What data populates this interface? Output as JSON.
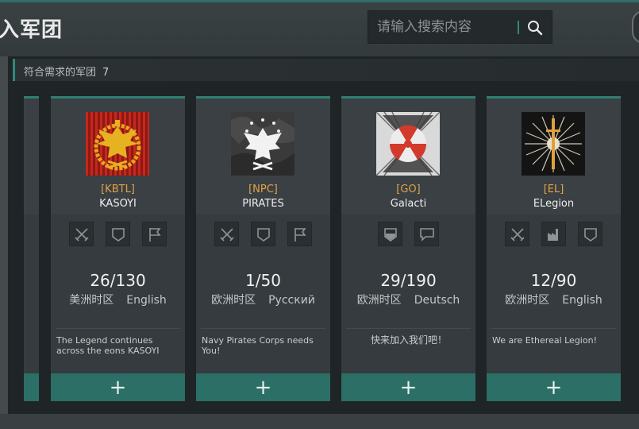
{
  "header": {
    "title": "入军团",
    "search_placeholder": "请输入搜索内容"
  },
  "list": {
    "count_label": "符合需求的军团",
    "count": "7"
  },
  "colors": {
    "accent": "#2f8a7c",
    "tag": "#e3a24a",
    "join_button": "#2b6f66"
  },
  "cards": [
    {
      "tag": "[KBTL]",
      "name": "KASOYI",
      "members": "26/130",
      "region": "美洲时区",
      "language": "English",
      "description": "The Legend continues across the eons    KASOYI",
      "badges": [
        "crossed-swords-icon",
        "shield-icon",
        "flag-icon"
      ],
      "join_label": "+"
    },
    {
      "tag": "[NPC]",
      "name": "PIRATES",
      "members": "1/50",
      "region": "欧洲时区",
      "language": "Русский",
      "description": "Navy Pirates Corps needs You!",
      "badges": [
        "crossed-swords-icon",
        "shield-icon",
        "flag-icon"
      ],
      "join_label": "+"
    },
    {
      "tag": "[GO]",
      "name": "Galacti",
      "members": "29/190",
      "region": "欧洲时区",
      "language": "Deutsch",
      "description": "快来加入我们吧！",
      "badges": [
        "filled-shield-icon",
        "chat-icon"
      ],
      "join_label": "+"
    },
    {
      "tag": "[EL]",
      "name": "ELegion",
      "members": "12/90",
      "region": "欧洲时区",
      "language": "English",
      "description": "We are Ethereal Legion!",
      "badges": [
        "crossed-swords-icon",
        "factory-icon",
        "shield-icon"
      ],
      "join_label": "+"
    }
  ]
}
